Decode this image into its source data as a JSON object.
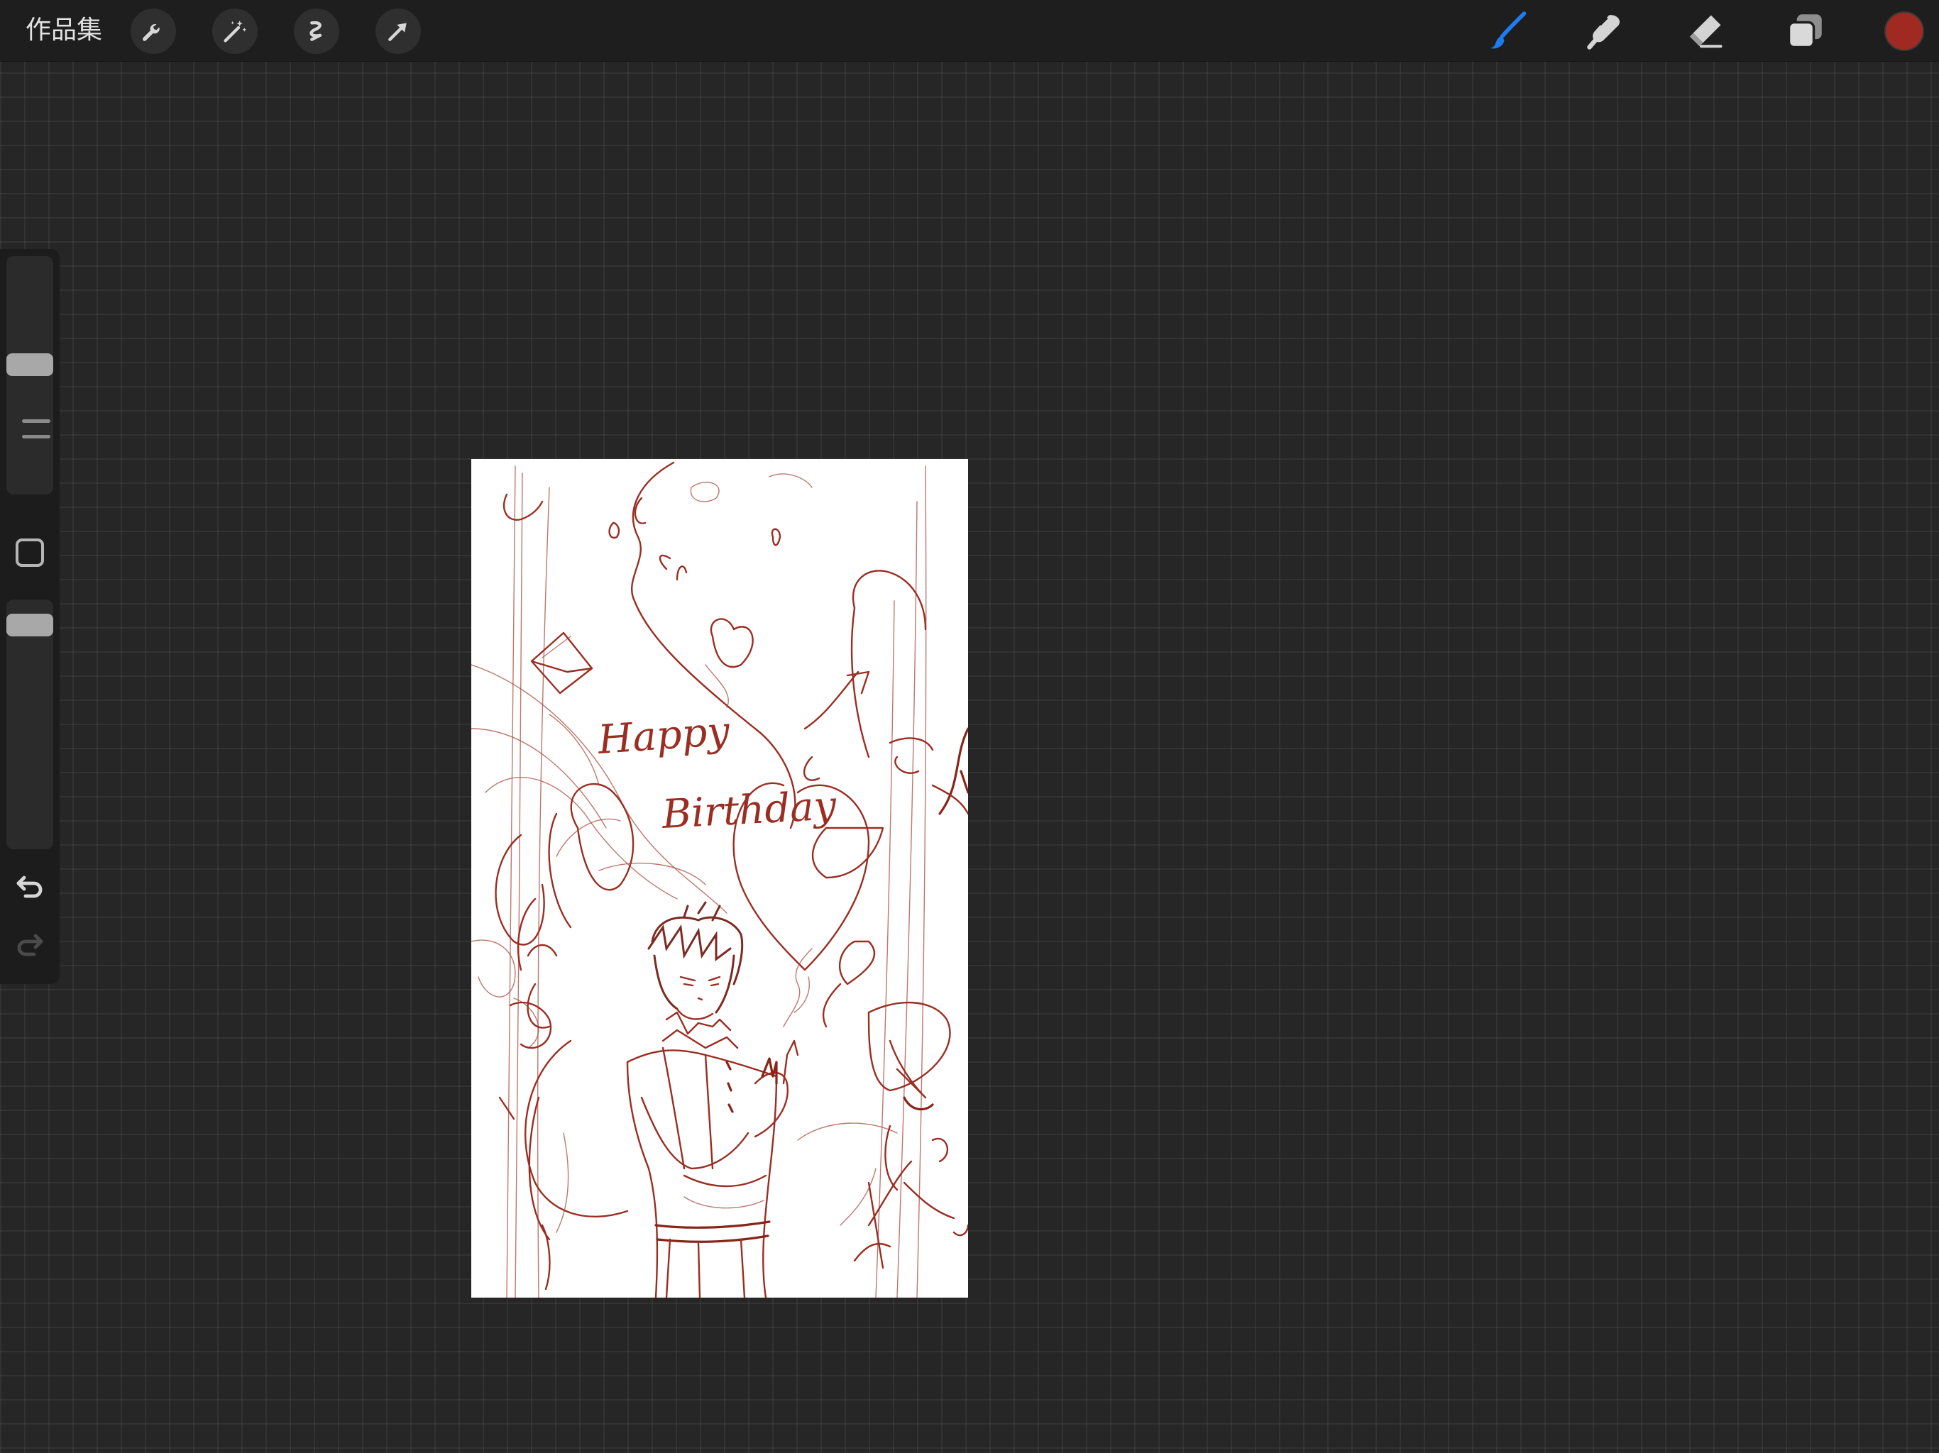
{
  "header": {
    "gallery_label": "作品集"
  },
  "toolbar_left": [
    {
      "name": "wrench-icon",
      "label": "actions"
    },
    {
      "name": "magic-wand-icon",
      "label": "adjustments"
    },
    {
      "name": "selection-icon",
      "label": "selection"
    },
    {
      "name": "transform-arrow-icon",
      "label": "transform"
    }
  ],
  "toolbar_right": [
    {
      "name": "brush-icon",
      "label": "paint",
      "active": true
    },
    {
      "name": "smudge-icon",
      "label": "smudge",
      "active": false
    },
    {
      "name": "eraser-icon",
      "label": "erase",
      "active": false
    },
    {
      "name": "layers-icon",
      "label": "layers",
      "active": false
    }
  ],
  "colors": {
    "active_color": "#a02a22",
    "active_tool_accent": "#1e7cf2",
    "ink": "#9a2e22",
    "background": "#262626"
  },
  "sidebar": {
    "brush_size_level": 0.55,
    "opacity_level": 0.95
  },
  "canvas": {
    "sketch_text": [
      "Happy",
      "Birthday"
    ]
  }
}
